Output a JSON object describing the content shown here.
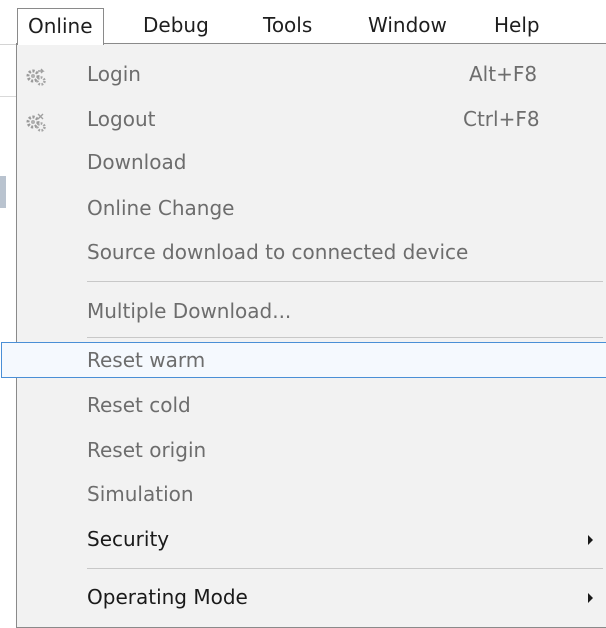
{
  "menubar": {
    "items": [
      "Online",
      "Debug",
      "Tools",
      "Window",
      "Help"
    ]
  },
  "menu": {
    "items": [
      {
        "label": "Login",
        "shortcut": "Alt+F8",
        "icon": "login-gears-icon"
      },
      {
        "label": "Logout",
        "shortcut": "Ctrl+F8",
        "icon": "logout-gears-icon"
      },
      {
        "label": "Download"
      },
      {
        "label": "Online Change"
      },
      {
        "label": "Source download to connected device"
      },
      {
        "label": "Multiple Download..."
      },
      {
        "label": "Reset warm"
      },
      {
        "label": "Reset cold"
      },
      {
        "label": "Reset origin"
      },
      {
        "label": "Simulation"
      },
      {
        "label": "Security",
        "submenu": true
      },
      {
        "label": "Operating Mode",
        "submenu": true
      }
    ]
  },
  "colors": {
    "disabled_text": "#6d6d6d",
    "enabled_text": "#1a1a1a",
    "highlight_border": "#4a8fd6",
    "menu_background": "#f2f2f2"
  }
}
